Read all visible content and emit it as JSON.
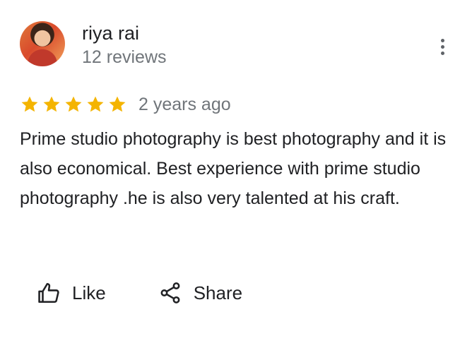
{
  "review": {
    "author": {
      "name": "riya rai",
      "meta": "12 reviews",
      "avatar_icon": "user-photo-avatar"
    },
    "rating": {
      "stars": 5,
      "max": 5,
      "star_color": "#f4b400"
    },
    "time": "2 years ago",
    "text": "Prime studio photography is best photography and it is also economical. Best experience with prime studio photography .he is also very talented at his craft.",
    "actions": {
      "like_label": "Like",
      "share_label": "Share"
    },
    "more_icon": "more-vert-icon"
  }
}
